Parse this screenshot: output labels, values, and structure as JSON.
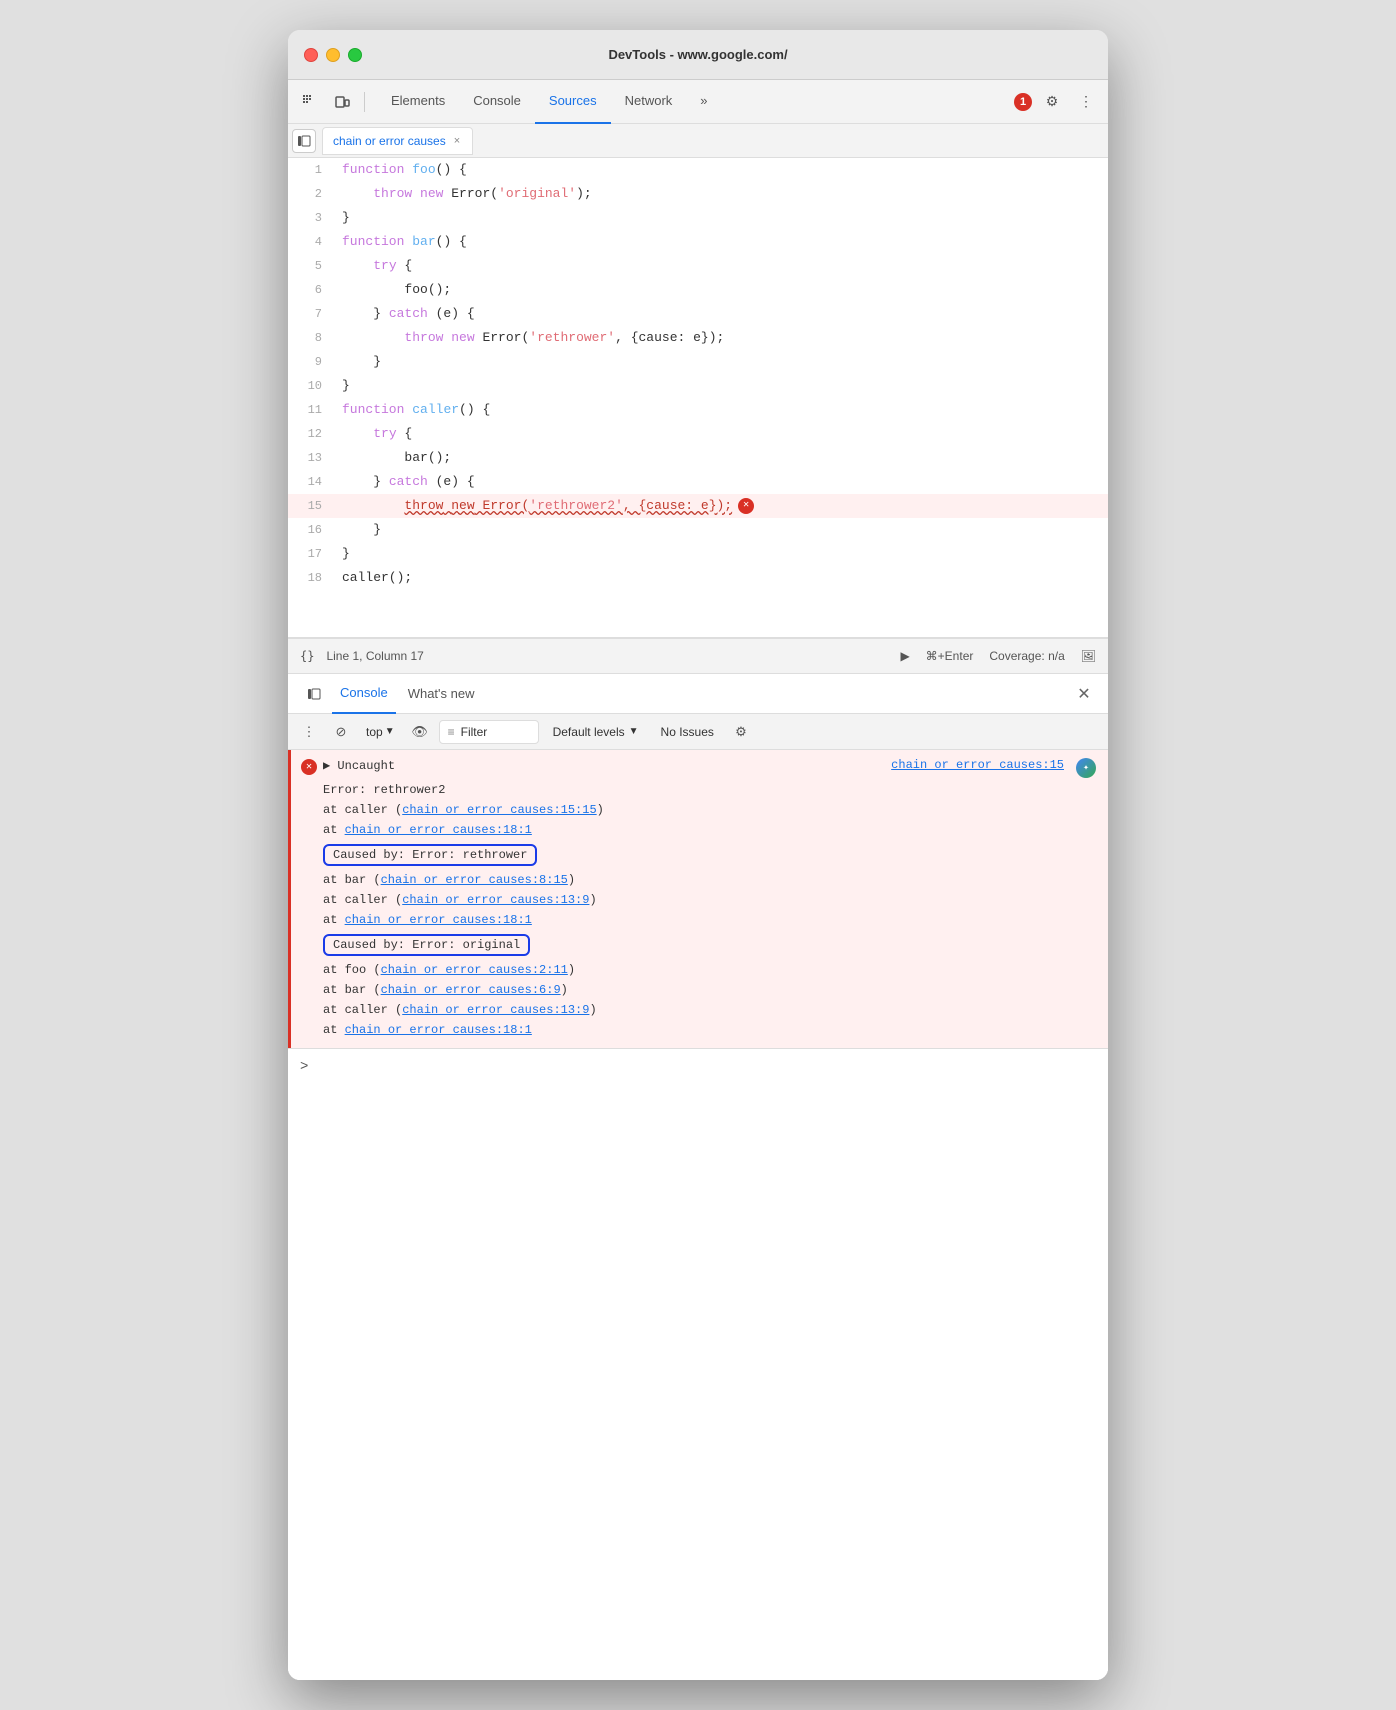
{
  "window": {
    "title": "DevTools - www.google.com/"
  },
  "toolbar": {
    "tabs": [
      {
        "id": "elements",
        "label": "Elements",
        "active": false
      },
      {
        "id": "console",
        "label": "Console",
        "active": false
      },
      {
        "id": "sources",
        "label": "Sources",
        "active": true
      },
      {
        "id": "network",
        "label": "Network",
        "active": false
      },
      {
        "id": "more",
        "label": "»",
        "active": false
      }
    ],
    "error_count": "1",
    "settings_icon": "⚙",
    "more_icon": "⋮"
  },
  "file_tab": {
    "label": "chain or error causes",
    "close_label": "×"
  },
  "code_editor": {
    "lines": [
      {
        "num": 1,
        "content": "function foo() {",
        "error": false
      },
      {
        "num": 2,
        "content": "    throw new Error('original');",
        "error": false
      },
      {
        "num": 3,
        "content": "}",
        "error": false
      },
      {
        "num": 4,
        "content": "function bar() {",
        "error": false
      },
      {
        "num": 5,
        "content": "    try {",
        "error": false
      },
      {
        "num": 6,
        "content": "        foo();",
        "error": false
      },
      {
        "num": 7,
        "content": "    } catch (e) {",
        "error": false
      },
      {
        "num": 8,
        "content": "        throw new Error('rethrower', {cause: e});",
        "error": false
      },
      {
        "num": 9,
        "content": "    }",
        "error": false
      },
      {
        "num": 10,
        "content": "}",
        "error": false
      },
      {
        "num": 11,
        "content": "function caller() {",
        "error": false
      },
      {
        "num": 12,
        "content": "    try {",
        "error": false
      },
      {
        "num": 13,
        "content": "        bar();",
        "error": false
      },
      {
        "num": 14,
        "content": "    } catch (e) {",
        "error": false
      },
      {
        "num": 15,
        "content": "        throw new Error('rethrower2', {cause: e});",
        "error": true
      },
      {
        "num": 16,
        "content": "    }",
        "error": false
      },
      {
        "num": 17,
        "content": "}",
        "error": false
      },
      {
        "num": 18,
        "content": "caller();",
        "error": false
      }
    ]
  },
  "status_bar": {
    "braces_label": "{}",
    "position": "Line 1, Column 17",
    "run_label": "▶",
    "shortcut": "⌘+Enter",
    "coverage": "Coverage: n/a",
    "screenshot_icon": "📷"
  },
  "console": {
    "tab_label": "Console",
    "whats_new_label": "What's new",
    "filter_placeholder": "Filter",
    "default_levels_label": "Default levels",
    "no_issues_label": "No Issues",
    "top_label": "top",
    "error_output": {
      "header_title": "▶ Uncaught",
      "source_link_header": "chain or error causes:15",
      "error_main": "Error: rethrower2",
      "stack_lines": [
        "at caller (chain or error causes:15:15)",
        "at chain or error causes:18:1"
      ],
      "caused_by_1": {
        "label": "Caused by: Error: rethrower",
        "stack_lines": [
          "at bar (chain or error causes:8:15)",
          "at caller (chain or error causes:13:9)",
          "at chain or error causes:18:1"
        ]
      },
      "caused_by_2": {
        "label": "Caused by: Error: original",
        "stack_lines": [
          "at foo (chain or error causes:2:11)",
          "at bar (chain or error causes:6:9)",
          "at caller (chain or error causes:13:9)",
          "at chain or error causes:18:1"
        ]
      }
    },
    "input_prompt": ">",
    "input_placeholder": ""
  }
}
